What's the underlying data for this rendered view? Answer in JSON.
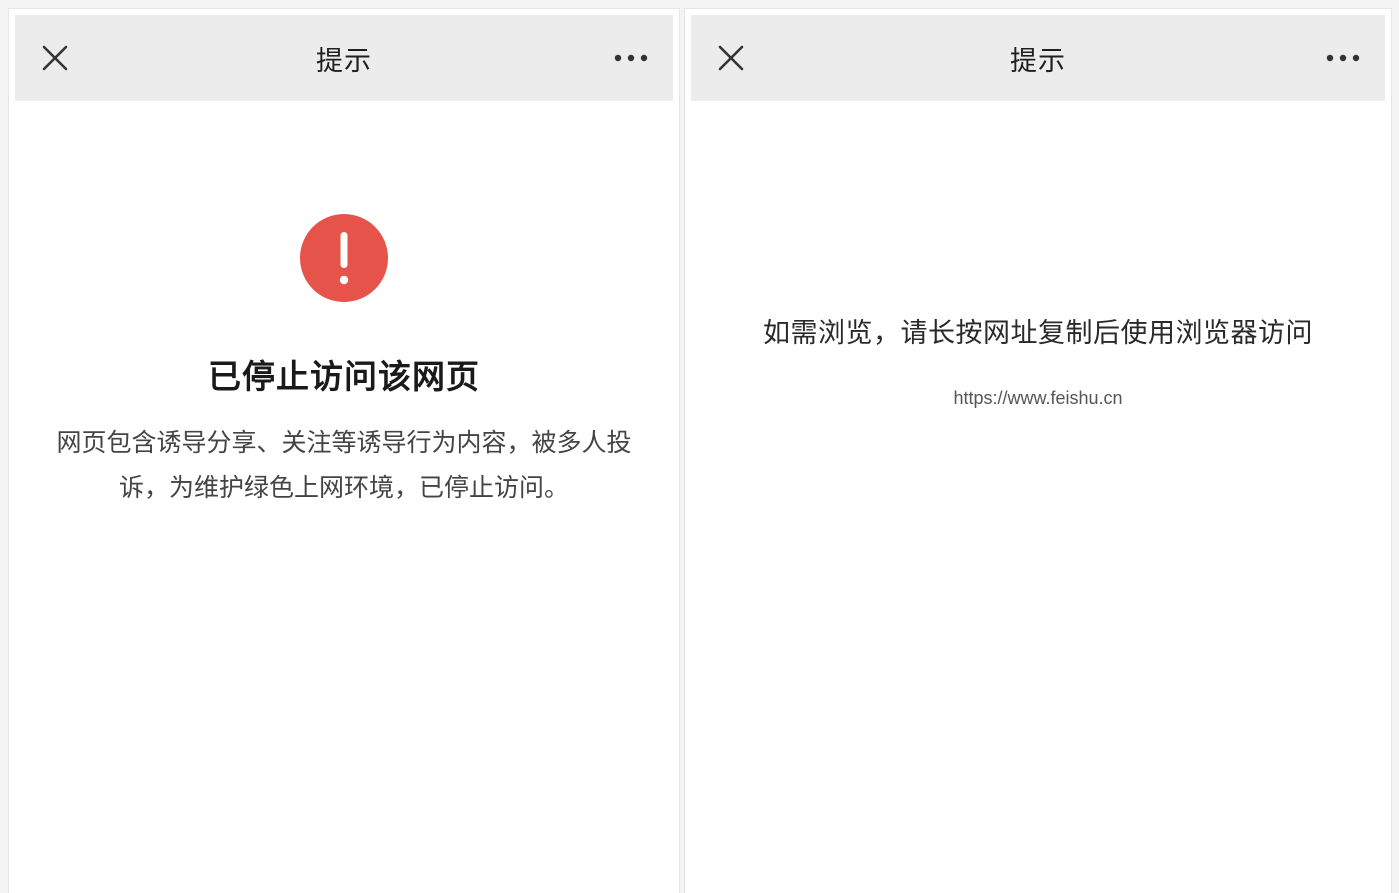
{
  "left_panel": {
    "title": "提示",
    "icons": {
      "close": "close-icon",
      "more": "more-icon",
      "warning": "warning-icon"
    },
    "headline": "已停止访问该网页",
    "description": "网页包含诱导分享、关注等诱导行为内容，被多人投诉，为维护绿色上网环境，已停止访问。",
    "warning_color": "#e5534b"
  },
  "right_panel": {
    "title": "提示",
    "icons": {
      "close": "close-icon",
      "more": "more-icon"
    },
    "hint": "如需浏览，请长按网址复制后使用浏览器访问",
    "url": "https://www.feishu.cn"
  }
}
